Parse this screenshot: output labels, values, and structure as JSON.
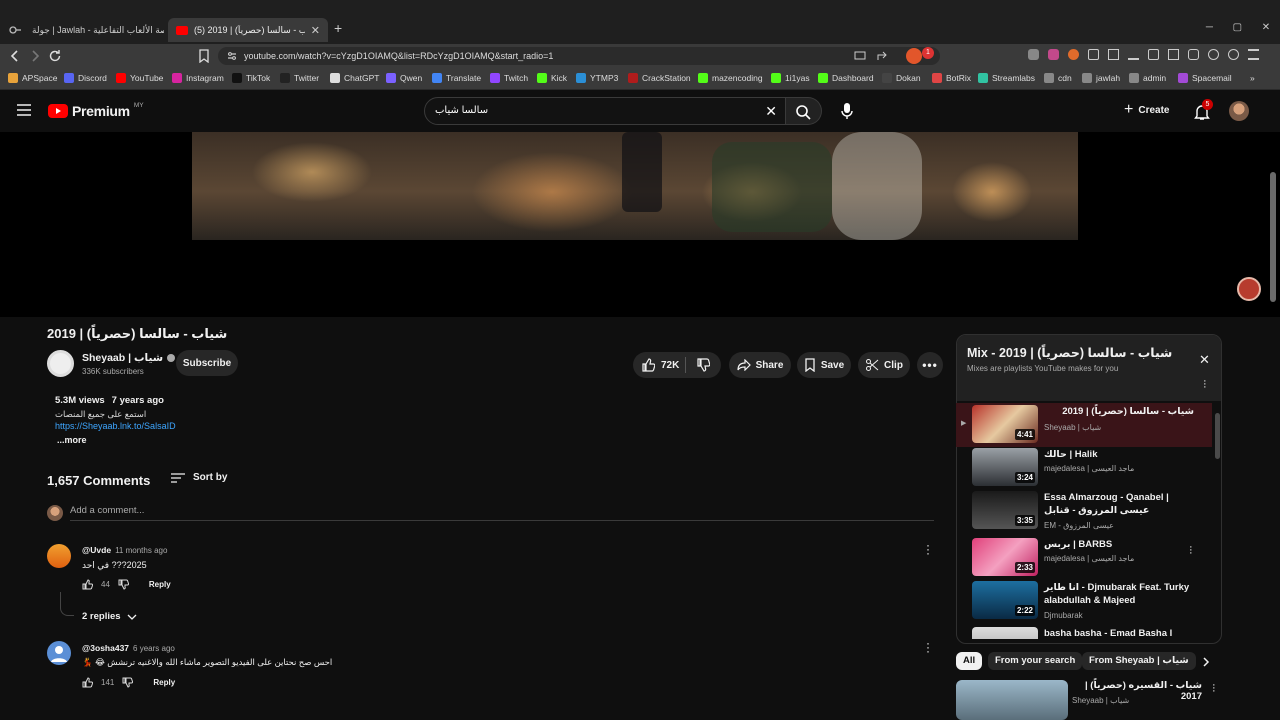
{
  "browser": {
    "tabs": [
      {
        "title": "جولة | Jawlah - منصة الألعاب التفاعلية"
      },
      {
        "title": "(5) شياب - سالسا (حصرياً) | 2019"
      }
    ],
    "new_tab_symbol": "+",
    "url": "youtube.com/watch?v=cYzgD1OIAMQ&list=RDcYzgD1OIAMQ&start_radio=1",
    "extensions_badge": "1",
    "bookmarks": [
      {
        "label": "APSpace",
        "color": "#e8a33b"
      },
      {
        "label": "Discord",
        "color": "#5865f2"
      },
      {
        "label": "YouTube",
        "color": "#ff0000"
      },
      {
        "label": "Instagram",
        "color": "#d6249f"
      },
      {
        "label": "TikTok",
        "color": "#111111"
      },
      {
        "label": "Twitter",
        "color": "#222222"
      },
      {
        "label": "ChatGPT",
        "color": "#dddddd"
      },
      {
        "label": "Qwen",
        "color": "#7b61ff"
      },
      {
        "label": "Translate",
        "color": "#4285f4"
      },
      {
        "label": "Twitch",
        "color": "#9146ff"
      },
      {
        "label": "Kick",
        "color": "#53fc18"
      },
      {
        "label": "YTMP3",
        "color": "#2b8fd6"
      },
      {
        "label": "CrackStation",
        "color": "#b01c1c"
      },
      {
        "label": "mazencoding",
        "color": "#53fc18"
      },
      {
        "label": "1i1yas",
        "color": "#53fc18"
      },
      {
        "label": "Dashboard",
        "color": "#53fc18"
      },
      {
        "label": "Dokan",
        "color": "#444444"
      },
      {
        "label": "BotRix",
        "color": "#e04545"
      },
      {
        "label": "Streamlabs",
        "color": "#31c3a2"
      },
      {
        "label": "cdn",
        "color": "#888888"
      },
      {
        "label": "jawlah",
        "color": "#888888"
      },
      {
        "label": "admin",
        "color": "#888888"
      },
      {
        "label": "Spacemail",
        "color": "#a34ad6"
      }
    ]
  },
  "masthead": {
    "logo_text": "Premium",
    "region": "MY",
    "search_value": "سالسا شياب",
    "create_label": "Create",
    "notifications_count": "5"
  },
  "video": {
    "title": "شياب - سالسا (حصرياً) | 2019",
    "channel_name": "Sheyaab | شياب",
    "subscribers": "336K subscribers",
    "subscribe_label": "Subscribe",
    "likes": "72K",
    "share_label": "Share",
    "save_label": "Save",
    "clip_label": "Clip",
    "views": "5.3M views",
    "age": "7 years ago",
    "description_line": "استمع على جميع المنصات",
    "link": "https://Sheyaab.lnk.to/SalsaID",
    "more_label": "...more"
  },
  "comments": {
    "count_label": "1,657 Comments",
    "sort_label": "Sort by",
    "add_placeholder": "Add a comment...",
    "items": [
      {
        "author": "@Uvde",
        "time": "11 months ago",
        "text": "2025??? في احد",
        "likes": "44",
        "reply": "Reply",
        "replies": "2 replies"
      },
      {
        "author": "@3osha437",
        "time": "6 years ago",
        "text": "احس صح نحتاين على الفيديو التصوير ماشاء الله والاغنيه ترنشش 😂 💃",
        "likes": "141",
        "reply": "Reply"
      }
    ]
  },
  "mix": {
    "title": "Mix - شياب - سالسا (حصرياً) | 2019",
    "subtitle": "Mixes are playlists YouTube makes for you",
    "items": [
      {
        "title": "شياب - سالسا (حصرياً) | 2019",
        "channel": "Sheyaab | شياب",
        "duration": "4:41",
        "playing": true
      },
      {
        "title": "حالك | Halik",
        "channel": "majedalesa | ماجد العيسى",
        "duration": "3:24"
      },
      {
        "title": "Essa Almarzoug - Qanabel | عيسى المرزوق - قنابل",
        "channel": "EM - عيسى المرزوق",
        "duration": "3:35"
      },
      {
        "title": "بربس | BARBS",
        "channel": "majedalesa | ماجد العيسى",
        "duration": "2:33"
      },
      {
        "title": "انا طاير - Djmubarak Feat. Turky alabdullah & Majeed",
        "channel": "Djmubarak",
        "duration": "2:22"
      },
      {
        "title": "basha basha - Emad Basha l",
        "channel": "",
        "duration": ""
      }
    ]
  },
  "chips": [
    "All",
    "From your search",
    "From Sheyaab | شياب"
  ],
  "recommended": {
    "title": "شياب - القسيره (حصرياً) | 2017",
    "channel": "Sheyaab | شياب"
  }
}
